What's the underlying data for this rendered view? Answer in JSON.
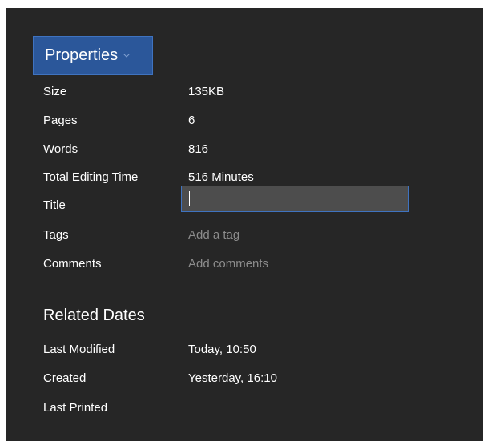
{
  "properties_button": {
    "label": "Properties",
    "icon": "chevron-down-icon"
  },
  "properties": {
    "size": {
      "label": "Size",
      "value": "135KB"
    },
    "pages": {
      "label": "Pages",
      "value": "6"
    },
    "words": {
      "label": "Words",
      "value": "816"
    },
    "editing_time": {
      "label": "Total Editing Time",
      "value": "516 Minutes"
    },
    "title": {
      "label": "Title",
      "value": "",
      "placeholder": ""
    },
    "tags": {
      "label": "Tags",
      "placeholder": "Add a tag"
    },
    "comments": {
      "label": "Comments",
      "placeholder": "Add comments"
    }
  },
  "related_dates": {
    "heading": "Related Dates",
    "last_modified": {
      "label": "Last Modified",
      "value": "Today, 10:50"
    },
    "created": {
      "label": "Created",
      "value": "Yesterday, 16:10"
    },
    "last_printed": {
      "label": "Last Printed",
      "value": ""
    }
  },
  "colors": {
    "background": "#262626",
    "accent": "#2b579a",
    "input_border": "#3f73c0",
    "input_fill": "#4d4d4d",
    "muted_text": "#8c8c8c"
  }
}
